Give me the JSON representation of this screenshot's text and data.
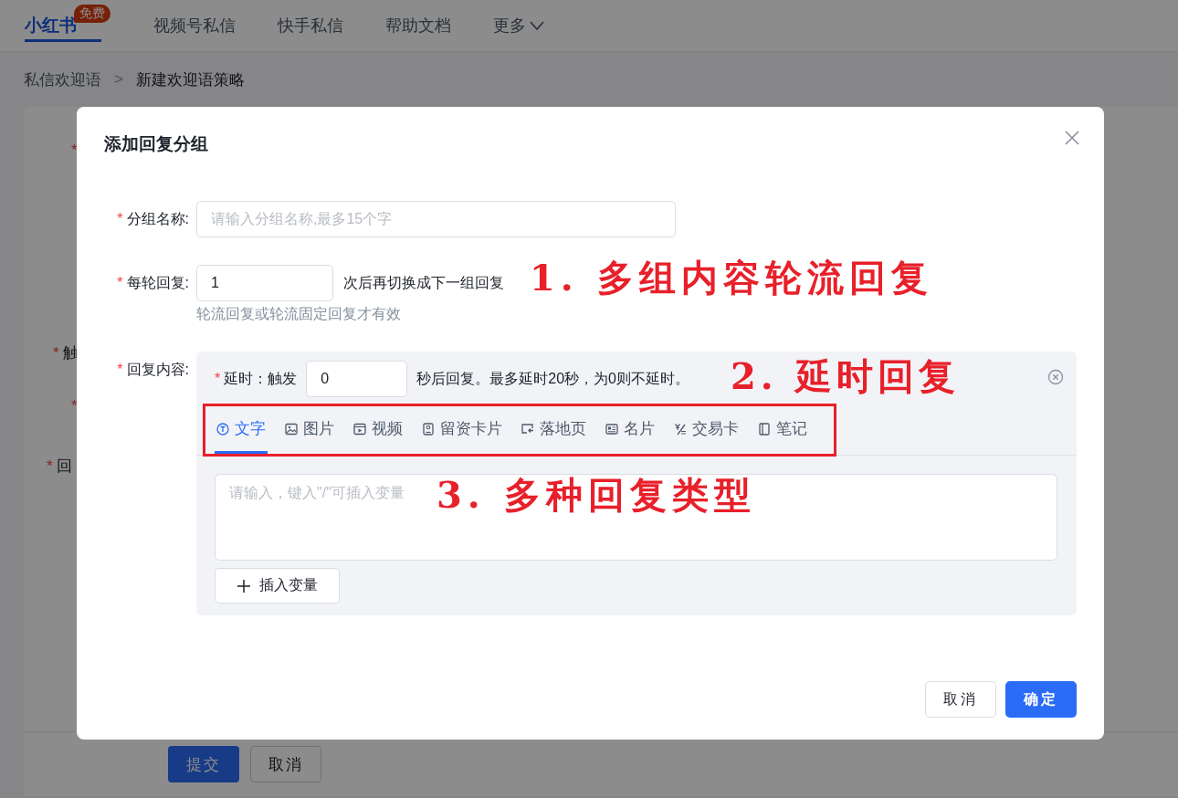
{
  "nav": {
    "items": [
      {
        "label": "小红书",
        "badge": "免费",
        "kind": "logo",
        "selected": true
      },
      {
        "label": "视频号私信",
        "kind": "tab",
        "selected": false
      },
      {
        "label": "快手私信",
        "kind": "tab",
        "selected": false
      },
      {
        "label": "帮助文档",
        "kind": "tab",
        "selected": false
      },
      {
        "label": "更多",
        "kind": "dropdown",
        "selected": false
      }
    ]
  },
  "breadcrumb": {
    "items": [
      "私信欢迎语",
      "新建欢迎语策略"
    ],
    "separator": ">"
  },
  "background_form": {
    "labels": [
      {
        "mark": "*"
      },
      {
        "mark": "*",
        "text": "触"
      },
      {
        "mark": "*"
      },
      {
        "mark": "*",
        "text": "回"
      }
    ]
  },
  "page_buttons": [
    {
      "label": "提交",
      "kind": "primary"
    },
    {
      "label": "取消",
      "kind": "default"
    }
  ],
  "modal": {
    "title": "添加回复分组",
    "group_name": {
      "mark": "*",
      "label": "分组名称:",
      "placeholder": "请输入分组名称,最多15个字"
    },
    "rounds": {
      "mark": "*",
      "label": "每轮回复:",
      "value": "1",
      "suffix": "次后再切换成下一组回复",
      "help": "轮流回复或轮流固定回复才有效"
    },
    "content": {
      "mark": "*",
      "label": "回复内容:",
      "delay": {
        "mark": "*",
        "label": "延时：触发",
        "value": "0",
        "suffix": "秒后回复。最多延时20秒，为0则不延时。"
      },
      "tabs": [
        {
          "label": "文字",
          "selected": true
        },
        {
          "label": "图片",
          "selected": false
        },
        {
          "label": "视频",
          "selected": false
        },
        {
          "label": "留资卡片",
          "selected": false
        },
        {
          "label": "落地页",
          "selected": false
        },
        {
          "label": "名片",
          "selected": false
        },
        {
          "label": "交易卡",
          "selected": false
        },
        {
          "label": "笔记",
          "selected": false
        }
      ],
      "placeholder": "请输入，键入\"/\"可插入变量",
      "insert_button": "插入变量"
    },
    "buttons": [
      {
        "label": "取消",
        "kind": "default"
      },
      {
        "label": "确定",
        "kind": "primary"
      }
    ]
  },
  "annotations": [
    {
      "text": "1. 多组内容轮流回复"
    },
    {
      "text": "2. 延时回复"
    },
    {
      "text": "3. 多种回复类型"
    }
  ]
}
